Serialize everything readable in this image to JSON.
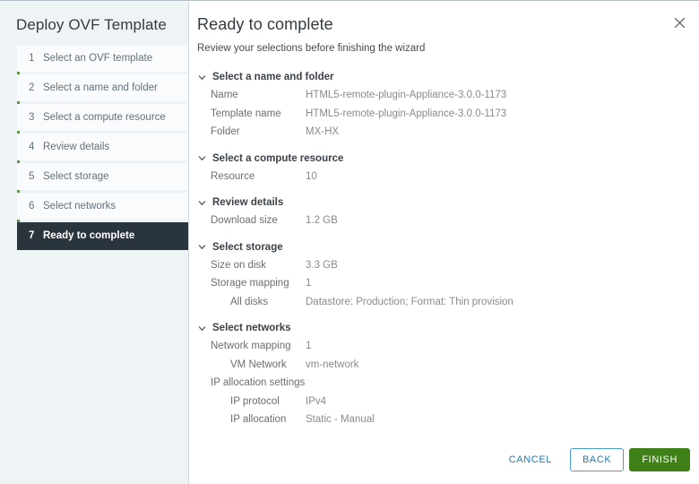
{
  "sidebar": {
    "title": "Deploy OVF Template",
    "steps": [
      {
        "num": "1",
        "label": "Select an OVF template",
        "active": false
      },
      {
        "num": "2",
        "label": "Select a name and folder",
        "active": false
      },
      {
        "num": "3",
        "label": "Select a compute resource",
        "active": false
      },
      {
        "num": "4",
        "label": "Review details",
        "active": false
      },
      {
        "num": "5",
        "label": "Select storage",
        "active": false
      },
      {
        "num": "6",
        "label": "Select networks",
        "active": false
      },
      {
        "num": "7",
        "label": "Ready to complete",
        "active": true
      }
    ],
    "rail_color": "#4fa127",
    "active_bg": "#29343d"
  },
  "header": {
    "title": "Ready to complete",
    "subtitle": "Review your selections before finishing the wizard",
    "close_icon": "close-icon"
  },
  "summary": {
    "chevron_icon": "chevron-down-icon",
    "sections": [
      {
        "title": "Select a name and folder",
        "rows": [
          {
            "label": "Name",
            "value": "HTML5-remote-plugin-Appliance-3.0.0-1173",
            "indent": false
          },
          {
            "label": "Template name",
            "value": "HTML5-remote-plugin-Appliance-3.0.0-1173",
            "indent": false
          },
          {
            "label": "Folder",
            "value": "MX-HX",
            "indent": false
          }
        ]
      },
      {
        "title": "Select a compute resource",
        "rows": [
          {
            "label": "Resource",
            "value": "10",
            "indent": false
          }
        ]
      },
      {
        "title": "Review details",
        "rows": [
          {
            "label": "Download size",
            "value": "1.2 GB",
            "indent": false
          }
        ]
      },
      {
        "title": "Select storage",
        "rows": [
          {
            "label": "Size on disk",
            "value": "3.3 GB",
            "indent": false
          },
          {
            "label": "Storage mapping",
            "value": "1",
            "indent": false
          },
          {
            "label": "All disks",
            "value": "Datastore: Production; Format: Thin provision",
            "indent": true
          }
        ]
      },
      {
        "title": "Select networks",
        "rows": [
          {
            "label": "Network mapping",
            "value": "1",
            "indent": false
          },
          {
            "label": "VM Network",
            "value": "vm-network",
            "indent": true
          },
          {
            "label": "IP allocation settings",
            "value": "",
            "indent": false
          },
          {
            "label": "IP protocol",
            "value": "IPv4",
            "indent": true
          },
          {
            "label": "IP allocation",
            "value": "Static - Manual",
            "indent": true
          }
        ]
      }
    ]
  },
  "footer": {
    "cancel_label": "CANCEL",
    "back_label": "BACK",
    "finish_label": "FINISH",
    "primary_color": "#3f8118",
    "link_color": "#1f7bb6"
  }
}
